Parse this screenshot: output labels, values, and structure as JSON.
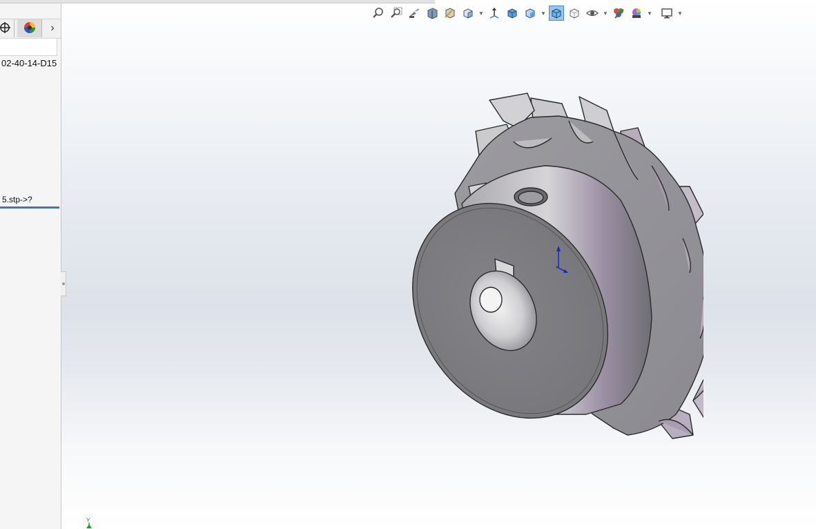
{
  "feature_manager": {
    "part_name": "02-40-14-D15",
    "tree_item": "5.stp->?",
    "tabs": [
      {
        "icon": "dimxpert-manager-icon"
      },
      {
        "icon": "display-manager-icon"
      }
    ],
    "more_tabs_icon": "chevron-right-icon"
  },
  "heads_up_toolbar": {
    "buttons": [
      {
        "icon": "zoom-to-fit-icon"
      },
      {
        "icon": "zoom-to-area-icon"
      },
      {
        "icon": "previous-view-icon"
      },
      {
        "icon": "section-view-icon"
      },
      {
        "icon": "dynamic-annotation-views-icon"
      },
      {
        "icon": "view-orientation-icon",
        "dropdown": true
      },
      {
        "icon": "display-style-icon"
      },
      {
        "icon": "shaded-with-edges-icon"
      },
      {
        "icon": "hide-show-items-icon",
        "dropdown": true
      },
      {
        "icon": "edit-appearance-icon",
        "active": true
      },
      {
        "icon": "apply-scene-icon"
      },
      {
        "icon": "view-settings-icon",
        "dropdown": true
      },
      {
        "icon": "realview-icon"
      },
      {
        "icon": "color-scene-icon",
        "dropdown": true
      },
      {
        "icon": "monitor-icon",
        "dropdown": true
      }
    ]
  },
  "viewport": {
    "model": "sprocket",
    "colors": {
      "accent": "#2b7cd3",
      "active_button": "#9cc3e8"
    }
  },
  "triad_label": "Y"
}
